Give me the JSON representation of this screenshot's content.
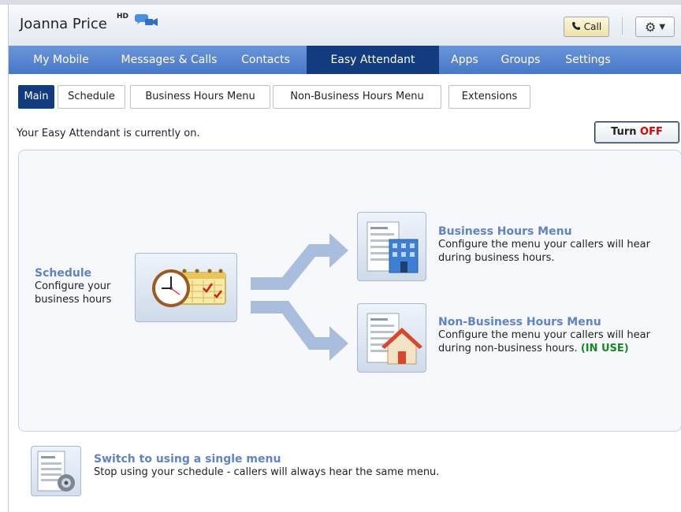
{
  "header": {
    "user_name": "Joanna Price",
    "hd_label": "HD",
    "video_icon": "video-chat-icon",
    "call_label": "Call",
    "gear_icon": "gear-icon"
  },
  "nav": {
    "items": [
      {
        "label": "My Mobile",
        "active": false
      },
      {
        "label": "Messages & Calls",
        "active": false
      },
      {
        "label": "Contacts",
        "active": false
      },
      {
        "label": "Easy Attendant",
        "active": true
      },
      {
        "label": "Apps",
        "active": false
      },
      {
        "label": "Groups",
        "active": false
      },
      {
        "label": "Settings",
        "active": false
      }
    ]
  },
  "subtabs": {
    "items": [
      {
        "label": "Main",
        "active": true
      },
      {
        "label": "Schedule",
        "active": false
      },
      {
        "label": "Business Hours Menu",
        "active": false
      },
      {
        "label": "Non-Business Hours Menu",
        "active": false
      },
      {
        "label": "Extensions",
        "active": false
      }
    ]
  },
  "status": {
    "text": "Your Easy Attendant is currently on.",
    "turn_label": "Turn",
    "off_label": "OFF"
  },
  "schedule": {
    "title": "Schedule",
    "desc_line1": "Configure your",
    "desc_line2": "business hours",
    "icon": "clock-calendar-icon"
  },
  "business_menu": {
    "title": "Business Hours Menu",
    "desc_line1": "Configure the menu your callers will hear",
    "desc_line2": "during business hours.",
    "icon": "office-building-icon"
  },
  "nonbusiness_menu": {
    "title": "Non-Business Hours Menu",
    "desc_line1": "Configure the menu your callers will hear",
    "desc_line2": "during non-business hours.",
    "in_use": "(IN USE)",
    "icon": "house-icon"
  },
  "single_menu": {
    "title": "Switch to using a single menu",
    "desc": "Stop using your schedule - callers will always hear the same menu.",
    "icon": "single-menu-icon"
  },
  "colors": {
    "nav_bg": "#4677c8",
    "nav_active": "#133b80",
    "link": "#5f83c6",
    "in_use": "#138a23",
    "off": "#e00000"
  }
}
